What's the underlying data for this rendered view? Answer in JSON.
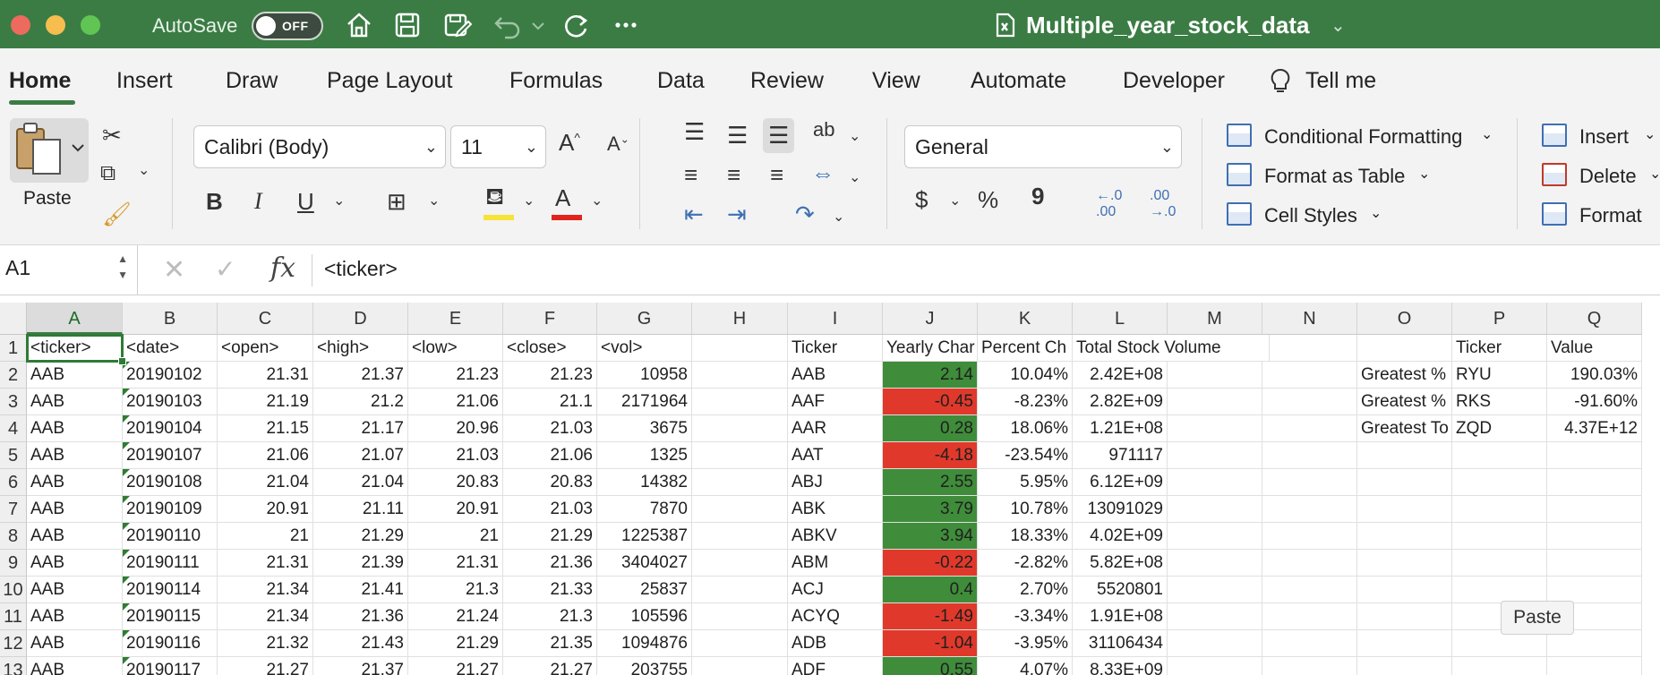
{
  "titlebar": {
    "autosave_label": "AutoSave",
    "autosave_state": "OFF",
    "document_title": "Multiple_year_stock_data",
    "accent_color": "#3b7c44"
  },
  "tabs": [
    "Home",
    "Insert",
    "Draw",
    "Page Layout",
    "Formulas",
    "Data",
    "Review",
    "View",
    "Automate",
    "Developer",
    "Tell me"
  ],
  "ribbon": {
    "paste_label": "Paste",
    "font_name": "Calibri (Body)",
    "font_size": "11",
    "number_format": "General",
    "conditional_formatting": "Conditional Formatting",
    "format_as_table": "Format as Table",
    "cell_styles": "Cell Styles",
    "insert": "Insert",
    "delete": "Delete",
    "format": "Format",
    "currency_symbol": "$",
    "percent_symbol": "%",
    "comma_symbol": "9"
  },
  "formula_bar": {
    "name_box": "A1",
    "fx": "fx",
    "value": "<ticker>"
  },
  "grid": {
    "columns": [
      "A",
      "B",
      "C",
      "D",
      "E",
      "F",
      "G",
      "H",
      "I",
      "J",
      "K",
      "L",
      "M",
      "N",
      "O",
      "P",
      "Q"
    ],
    "selected_column": "A",
    "row_numbers": [
      "1",
      "2",
      "3",
      "4",
      "5",
      "6",
      "7",
      "8",
      "9",
      "10",
      "11",
      "12",
      "13"
    ],
    "header_row": [
      "<ticker>",
      "<date>",
      "<open>",
      "<high>",
      "<low>",
      "<close>",
      "<vol>",
      "",
      "Ticker",
      "Yearly Char",
      "Percent Ch",
      "Total Stock Volume",
      "",
      "",
      "",
      "Ticker",
      "Value"
    ],
    "raw_rows": [
      [
        "AAB",
        "20190102",
        "21.31",
        "21.37",
        "21.23",
        "21.23",
        "10958"
      ],
      [
        "AAB",
        "20190103",
        "21.19",
        "21.2",
        "21.06",
        "21.1",
        "2171964"
      ],
      [
        "AAB",
        "20190104",
        "21.15",
        "21.17",
        "20.96",
        "21.03",
        "3675"
      ],
      [
        "AAB",
        "20190107",
        "21.06",
        "21.07",
        "21.03",
        "21.06",
        "1325"
      ],
      [
        "AAB",
        "20190108",
        "21.04",
        "21.04",
        "20.83",
        "20.83",
        "14382"
      ],
      [
        "AAB",
        "20190109",
        "20.91",
        "21.11",
        "20.91",
        "21.03",
        "7870"
      ],
      [
        "AAB",
        "20190110",
        "21",
        "21.29",
        "21",
        "21.29",
        "1225387"
      ],
      [
        "AAB",
        "20190111",
        "21.31",
        "21.39",
        "21.31",
        "21.36",
        "3404027"
      ],
      [
        "AAB",
        "20190114",
        "21.34",
        "21.41",
        "21.3",
        "21.33",
        "25837"
      ],
      [
        "AAB",
        "20190115",
        "21.34",
        "21.36",
        "21.24",
        "21.3",
        "105596"
      ],
      [
        "AAB",
        "20190116",
        "21.32",
        "21.43",
        "21.29",
        "21.35",
        "1094876"
      ],
      [
        "AAB",
        "20190117",
        "21.27",
        "21.37",
        "21.27",
        "21.27",
        "203755"
      ]
    ],
    "summary_rows": [
      {
        "ticker": "AAB",
        "yearly": "2.14",
        "status": "positive",
        "percent": "10.04%",
        "volume": "2.42E+08"
      },
      {
        "ticker": "AAF",
        "yearly": "-0.45",
        "status": "negative",
        "percent": "-8.23%",
        "volume": "2.82E+09"
      },
      {
        "ticker": "AAR",
        "yearly": "0.28",
        "status": "positive",
        "percent": "18.06%",
        "volume": "1.21E+08"
      },
      {
        "ticker": "AAT",
        "yearly": "-4.18",
        "status": "negative",
        "percent": "-23.54%",
        "volume": "971117"
      },
      {
        "ticker": "ABJ",
        "yearly": "2.55",
        "status": "positive",
        "percent": "5.95%",
        "volume": "6.12E+09"
      },
      {
        "ticker": "ABK",
        "yearly": "3.79",
        "status": "positive",
        "percent": "10.78%",
        "volume": "13091029"
      },
      {
        "ticker": "ABKV",
        "yearly": "3.94",
        "status": "positive",
        "percent": "18.33%",
        "volume": "4.02E+09"
      },
      {
        "ticker": "ABM",
        "yearly": "-0.22",
        "status": "negative",
        "percent": "-2.82%",
        "volume": "5.82E+08"
      },
      {
        "ticker": "ACJ",
        "yearly": "0.4",
        "status": "positive",
        "percent": "2.70%",
        "volume": "5520801"
      },
      {
        "ticker": "ACYQ",
        "yearly": "-1.49",
        "status": "negative",
        "percent": "-3.34%",
        "volume": "1.91E+08"
      },
      {
        "ticker": "ADB",
        "yearly": "-1.04",
        "status": "negative",
        "percent": "-3.95%",
        "volume": "31106434"
      },
      {
        "ticker": "ADF",
        "yearly": "0.55",
        "status": "positive",
        "percent": "4.07%",
        "volume": "8.33E+09"
      }
    ],
    "greatest_rows": [
      {
        "label": "Greatest %",
        "ticker": "RYU",
        "value": "190.03%"
      },
      {
        "label": "Greatest %",
        "ticker": "RKS",
        "value": "-91.60%"
      },
      {
        "label": "Greatest To",
        "ticker": "ZQD",
        "value": "4.37E+12"
      }
    ],
    "positive_color": "#3f8c3a",
    "negative_color": "#e0392b"
  },
  "tooltip": "Paste"
}
